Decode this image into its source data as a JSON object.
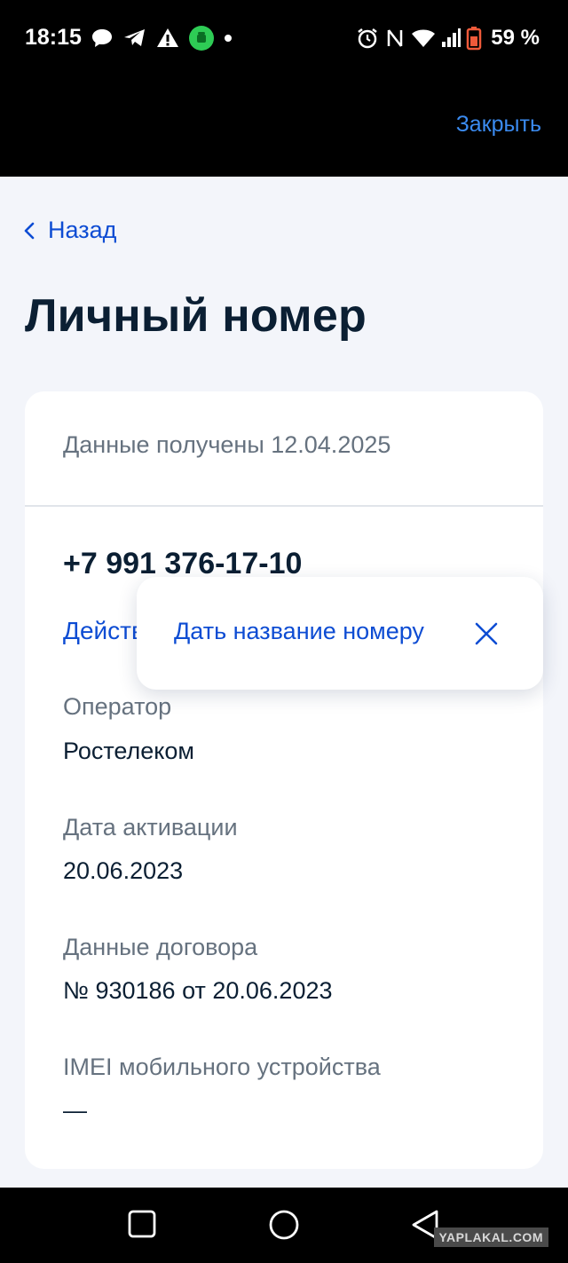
{
  "status_bar": {
    "time": "18:15",
    "battery_percent": "59 %",
    "left_icons": [
      "chat-bubble-icon",
      "telegram-icon",
      "warning-icon",
      "android-app-icon",
      "dot-icon"
    ],
    "right_icons": [
      "alarm-icon",
      "nfc-icon",
      "wifi-icon",
      "signal-icon",
      "battery-icon"
    ]
  },
  "header": {
    "close_label": "Закрыть"
  },
  "nav": {
    "back_label": "Назад"
  },
  "page": {
    "title": "Личный номер"
  },
  "card": {
    "received": "Данные получены 12.04.2025",
    "phone": "+7 991 376-17-10",
    "actions_label": "Действия",
    "fields": [
      {
        "label": "Оператор",
        "value": "Ростелеком"
      },
      {
        "label": "Дата активации",
        "value": "20.06.2023"
      },
      {
        "label": "Данные договора",
        "value": "№ 930186 от 20.06.2023"
      },
      {
        "label": "IMEI мобильного устройства",
        "value": "—"
      }
    ]
  },
  "popup": {
    "item_label": "Дать название номеру"
  },
  "watermark": "YAPLAKAL.COM",
  "colors": {
    "accent": "#0d4cd3",
    "header_link": "#3b8bf0",
    "title": "#0b1f33",
    "muted": "#66727f",
    "background": "#f3f5fa"
  }
}
